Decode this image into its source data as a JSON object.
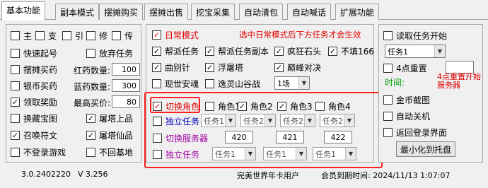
{
  "tabs": [
    "基本功能",
    "副本模式",
    "摆摊购买",
    "摆摊出售",
    "挖宝采集",
    "自动清包",
    "自动喊话",
    "扩展功能"
  ],
  "left": {
    "row1": [
      "主",
      "支",
      "引",
      "修",
      "传"
    ],
    "quick_rise": "快速起号",
    "give_up_task": "放弃任务",
    "buy_stall": "摆摊买药",
    "red_qty_label": "红药数量:",
    "red_qty": "100",
    "silver_buy": "银币买药",
    "blue_qty_label": "蓝药数量:",
    "blue_qty": "300",
    "claim_reward": "领取奖励",
    "max_price_label": "最高买价:",
    "max_price": "80",
    "exchange_map": "换藏宝图",
    "tower_upper": "屠塔上品",
    "summon_talisman": "召唤符文",
    "tower_immortal": "屠塔仙品",
    "no_login": "不登录游戏",
    "no_return": "不回基地"
  },
  "middle": {
    "daily_mode": "日常模式",
    "hint": "选中日常模式后下方任务才会生效",
    "tasks": [
      "帮派任务",
      "帮派任务副本",
      "疯狂石头",
      "不填166",
      "曲别针",
      "浮屠塔",
      "巅峰对决",
      "现世安魂",
      "逸灵山谷战"
    ],
    "field_select": "1场",
    "switch_role": "切换角色",
    "roles": [
      "角色1",
      "角色2",
      "角色3",
      "角色4"
    ],
    "independent_task": "独立任务",
    "task_placeholders": [
      "任务1",
      "任务2",
      "任务2",
      "任务2"
    ],
    "switch_server": "切换服务器",
    "servers": [
      "420",
      "421",
      "422"
    ],
    "independent_task2": "独立任务",
    "task_sel2": [
      "任务1",
      "任务1",
      "任务1"
    ]
  },
  "right": {
    "read_task_start": "读取任务开始",
    "task_select": "任务1",
    "reset_at4": "4点重置",
    "time_label": "时间:",
    "reset_note": "4点重置开始服务器",
    "gold_screenshot": "金币截图",
    "auto_shutdown": "自动关机",
    "return_login": "返回登录界面",
    "minimize_tray": "最小化到托盘"
  },
  "status": {
    "version1": "3.0.2402220",
    "version2": "V 3.256",
    "user_type": "完美世界年卡用户",
    "expire": "会员到期时间: 2024/11/13 1:07:07"
  }
}
